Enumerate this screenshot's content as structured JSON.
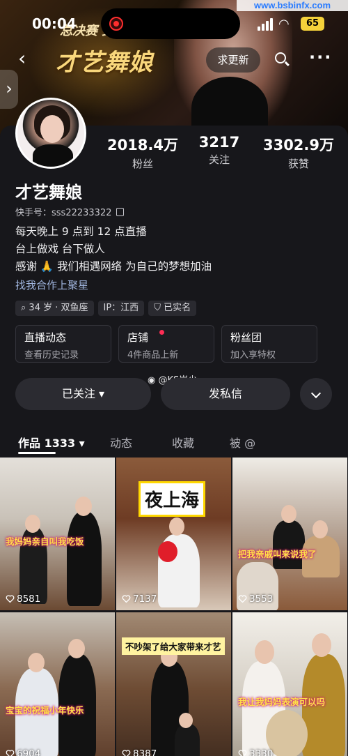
{
  "status_bar": {
    "time": "00:04",
    "battery": "65",
    "watermark": "www.bsbinfx.com"
  },
  "cover": {
    "caption_line1": "总决赛 女明星冠军",
    "caption_line2": "才艺舞娘"
  },
  "nav": {
    "back_icon": "chevron-left-icon",
    "update_label": "求更新",
    "search_icon": "search-icon",
    "more_icon": "more-dots-icon"
  },
  "profile": {
    "name": "才艺舞娘",
    "kuaishou_id": "快手号：sss22233322",
    "stats": [
      {
        "value": "2018.4万",
        "label": "粉丝"
      },
      {
        "value": "3217",
        "label": "关注"
      },
      {
        "value": "3302.9万",
        "label": "获赞"
      }
    ],
    "bio": [
      "每天晚上 9 点到 12 点直播",
      "台上做戏   台下做人",
      "感谢 🙏 我们相遇网络  为自己的梦想加油"
    ],
    "bio_link": "找我合作上聚星",
    "chips": [
      "34 岁 · 双鱼座",
      "IP：江西",
      "已实名"
    ]
  },
  "cards": [
    {
      "title": "直播动态",
      "subtitle": "查看历史记录"
    },
    {
      "title": "店铺",
      "subtitle": "4件商品上新"
    },
    {
      "title": "粉丝团",
      "subtitle": "加入享特权"
    }
  ],
  "weibo_tag": "@KS岩少",
  "actions": {
    "follow": "已关注 ▾",
    "message": "发私信"
  },
  "tabs": [
    "作品 1333 ▾",
    "动态",
    "收藏",
    "被 @"
  ],
  "videos": [
    {
      "caption": "我妈妈亲自叫我吃饭",
      "likes": "8581"
    },
    {
      "caption": "夜上海",
      "likes": "7137"
    },
    {
      "caption": "把我亲戚叫来说我了",
      "likes": "3553"
    },
    {
      "caption": "宝宝的祝福小年快乐",
      "likes": "6904"
    },
    {
      "caption": "不吵架了给大家带来才艺",
      "likes": "8387"
    },
    {
      "caption": "我让我妈妈表演可以吗",
      "likes": "3330"
    }
  ],
  "colors": {
    "background": "#17171b",
    "accent_red": "#ff2d55",
    "link": "#9fb4dd"
  }
}
